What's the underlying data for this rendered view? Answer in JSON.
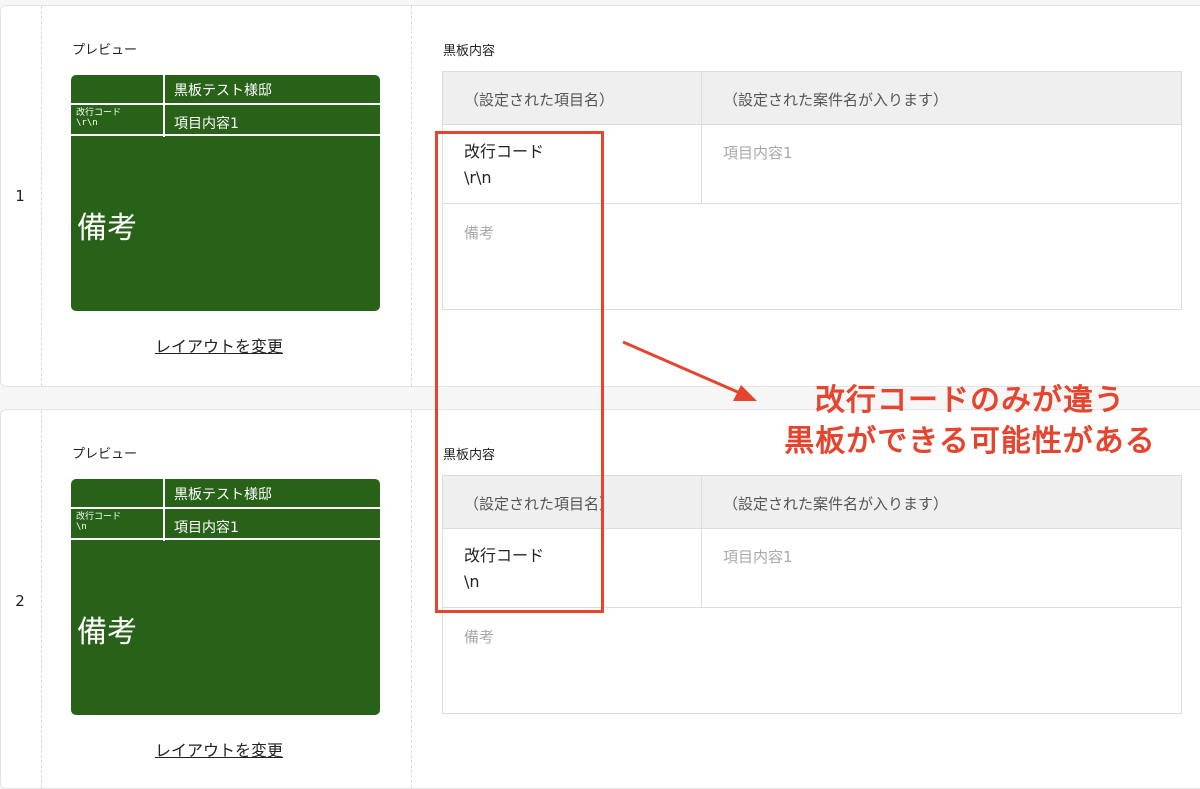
{
  "rows": [
    {
      "number": "1",
      "preview_label": "プレビュー",
      "board": {
        "title": "黒板テスト様邸",
        "item_label": "改行コード\n\\r\\n",
        "item_value": "項目内容1",
        "note": "備考"
      },
      "change_layout_link": "レイアウトを変更",
      "content_label": "黒板内容",
      "table": {
        "header_item": "（設定された項目名）",
        "header_project": "（設定された案件名が入ります）",
        "item_name_line1": "改行コード",
        "item_name_line2": "\\r\\n",
        "item_value_placeholder": "項目内容1",
        "note_placeholder": "備考"
      }
    },
    {
      "number": "2",
      "preview_label": "プレビュー",
      "board": {
        "title": "黒板テスト様邸",
        "item_label": "改行コード\n\\n",
        "item_value": "項目内容1",
        "note": "備考"
      },
      "change_layout_link": "レイアウトを変更",
      "content_label": "黒板内容",
      "table": {
        "header_item": "（設定された項目名）",
        "header_project": "（設定された案件名が入ります）",
        "item_name_line1": "改行コード",
        "item_name_line2": "\\n",
        "item_value_placeholder": "項目内容1",
        "note_placeholder": "備考"
      }
    }
  ],
  "annotation": {
    "line1": "改行コードのみが違う",
    "line2": "黒板ができる可能性がある",
    "color": "#e5452f"
  },
  "colors": {
    "board_green": "#286218",
    "table_header_bg": "#efefef",
    "annotation_red": "#e5452f"
  }
}
